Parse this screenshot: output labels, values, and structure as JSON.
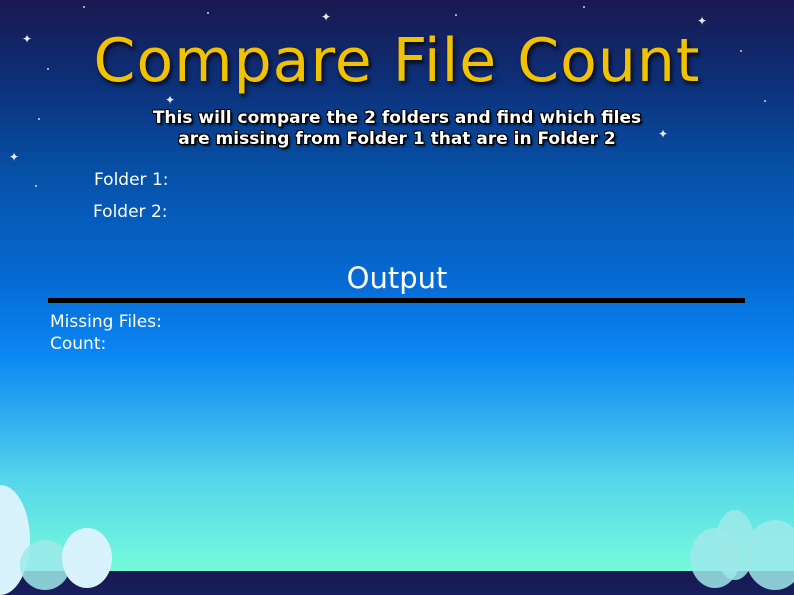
{
  "header": {
    "title": "Compare File Count",
    "subtitle_line1": "This will compare the 2 folders and find which files",
    "subtitle_line2": "are missing from Folder 1 that are in Folder 2"
  },
  "inputs": {
    "folder1_label": "Folder 1:",
    "folder2_label": "Folder 2:"
  },
  "output": {
    "heading": "Output",
    "missing_files_label": "Missing Files:",
    "count_label": "Count:"
  },
  "colors": {
    "title": "#f2c200",
    "text": "#ffffff"
  }
}
